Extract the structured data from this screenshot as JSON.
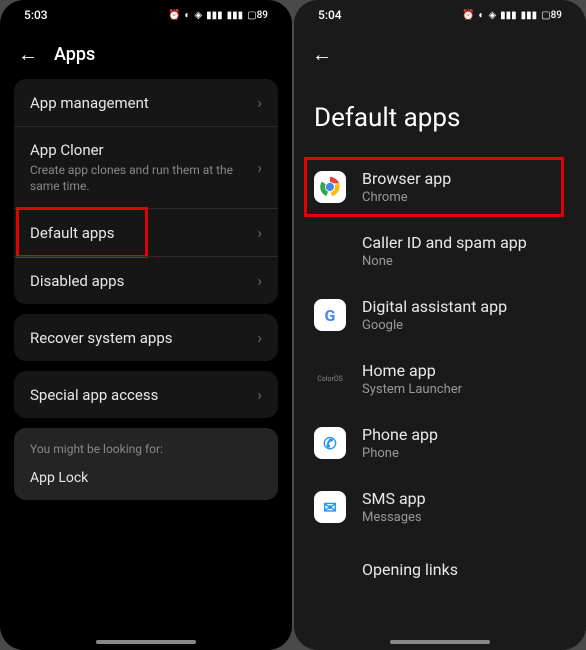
{
  "left": {
    "status": {
      "time": "5:03",
      "battery": "89"
    },
    "header": {
      "title": "Apps"
    },
    "group1": [
      {
        "title": "App management"
      },
      {
        "title": "App Cloner",
        "subtitle": "Create app clones and run them at the same time."
      },
      {
        "title": "Default apps",
        "highlight": true
      },
      {
        "title": "Disabled apps"
      }
    ],
    "group2": [
      {
        "title": "Recover system apps"
      }
    ],
    "group3": [
      {
        "title": "Special app access"
      }
    ],
    "suggest": {
      "label": "You might be looking for:",
      "item": "App Lock"
    }
  },
  "right": {
    "status": {
      "time": "5:04",
      "battery": "89"
    },
    "pageTitle": "Default apps",
    "items": [
      {
        "title": "Browser app",
        "subtitle": "Chrome",
        "icon": "chrome",
        "highlight": true
      },
      {
        "title": "Caller ID and spam app",
        "subtitle": "None",
        "icon": "empty"
      },
      {
        "title": "Digital assistant app",
        "subtitle": "Google",
        "icon": "google"
      },
      {
        "title": "Home app",
        "subtitle": "System Launcher",
        "icon": "coloros"
      },
      {
        "title": "Phone app",
        "subtitle": "Phone",
        "icon": "phone"
      },
      {
        "title": "SMS app",
        "subtitle": "Messages",
        "icon": "sms"
      },
      {
        "title": "Opening links",
        "icon": "empty"
      }
    ]
  }
}
